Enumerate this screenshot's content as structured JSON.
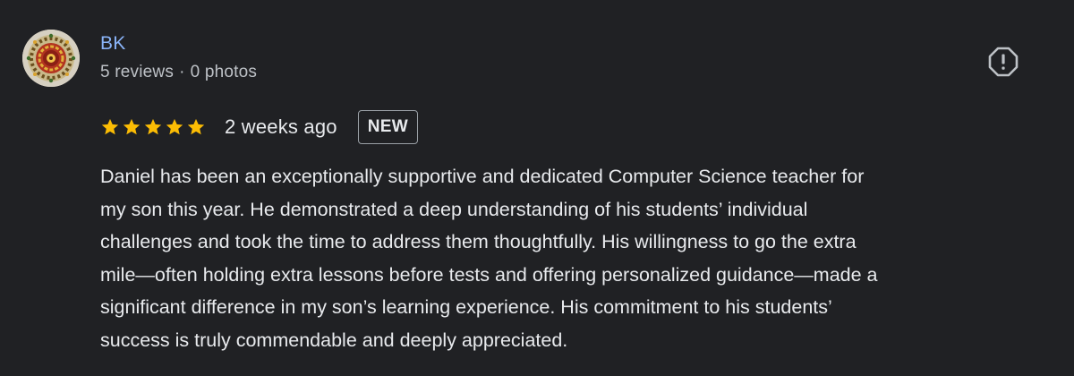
{
  "review": {
    "author": {
      "name": "BK",
      "reviews_count": "5 reviews",
      "separator": "·",
      "photos_count": "0 photos",
      "avatar_icon": "avatar-image"
    },
    "report_icon": "report-flag-icon",
    "rating": 5,
    "rating_max": 5,
    "star_color": "#fbbc04",
    "date": "2 weeks ago",
    "badge": "NEW",
    "text_lines": [
      "Daniel has been an exceptionally supportive and dedicated Computer Science teacher for",
      "my son this year. He demonstrated a deep understanding of his students’ individual",
      "challenges and took the time to address them thoughtfully. His willingness to go the extra",
      "mile—often holding extra lessons before tests and offering personalized guidance—made a",
      "significant difference in my son’s learning experience. His commitment to his students’",
      "success is truly commendable and deeply appreciated."
    ]
  },
  "colors": {
    "background": "#202124",
    "author_link": "#8ab4f8",
    "secondary_text": "#bdc1c6",
    "primary_text": "#e8eaed"
  }
}
